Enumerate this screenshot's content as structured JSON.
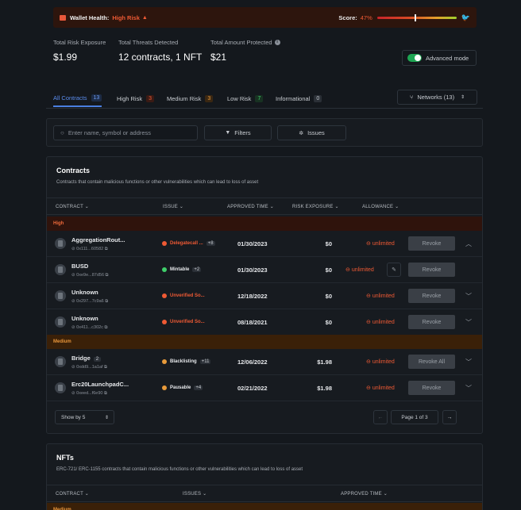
{
  "banner": {
    "label": "Wallet Health:",
    "status": "High Risk",
    "score_label": "Score:",
    "score_value": "47%",
    "score_fraction": 0.47
  },
  "stats": [
    {
      "label": "Total Risk Exposure",
      "value": "$1.99"
    },
    {
      "label": "Total Threats Detected",
      "value": "12 contracts, 1 NFT"
    },
    {
      "label": "Total Amount Protected",
      "value": "$21"
    }
  ],
  "advanced_mode": {
    "label": "Advanced mode",
    "enabled": true
  },
  "tabs": [
    {
      "label": "All Contracts",
      "count": "13"
    },
    {
      "label": "High Risk",
      "count": "3"
    },
    {
      "label": "Medium Risk",
      "count": "3"
    },
    {
      "label": "Low Risk",
      "count": "7"
    },
    {
      "label": "Informational",
      "count": "0"
    }
  ],
  "networks": {
    "label": "Networks (13)"
  },
  "filters": {
    "search_placeholder": "Enter name, symbol or address",
    "filters_label": "Filters",
    "issues_label": "Issues"
  },
  "contracts": {
    "title": "Contracts",
    "subtitle": "Contracts that contain malicious functions or other vulnerabilities which can lead to loss of asset",
    "headers": {
      "contract": "CONTRACT",
      "issue": "ISSUE",
      "approved": "APPROVED TIME",
      "exposure": "RISK EXPOSURE",
      "allowance": "ALLOWANCE"
    },
    "group_high": "High",
    "group_medium": "Medium",
    "rows": [
      {
        "name": "AggregationRout...",
        "address": "0x111...60582",
        "issue": "Delegatecall ...",
        "issue_more": "+8",
        "date": "01/30/2023",
        "exposure": "$0",
        "allowance": "unlimited",
        "action": "Revoke"
      },
      {
        "name": "BUSD",
        "address": "0xe9e...87d56",
        "issue": "Mintable",
        "issue_more": "+2",
        "date": "01/30/2023",
        "exposure": "$0",
        "allowance": "unlimited",
        "action": "Revoke"
      },
      {
        "name": "Unknown",
        "address": "0x297...7c9a6",
        "issue": "Unverified So...",
        "issue_more": "",
        "date": "12/18/2022",
        "exposure": "$0",
        "allowance": "unlimited",
        "action": "Revoke"
      },
      {
        "name": "Unknown",
        "address": "0x411...c302c",
        "issue": "Unverified So...",
        "issue_more": "",
        "date": "08/18/2021",
        "exposure": "$0",
        "allowance": "unlimited",
        "action": "Revoke"
      },
      {
        "name": "Bridge",
        "count": "2",
        "address": "0xdd9...1a1af",
        "issue": "Blacklisting",
        "issue_more": "+11",
        "date": "12/06/2022",
        "exposure": "$1.98",
        "allowance": "unlimited",
        "action": "Revoke All"
      },
      {
        "name": "Erc20LaunchpadC...",
        "address": "0xeed...f6e90",
        "issue": "Pausable",
        "issue_more": "+4",
        "date": "02/21/2022",
        "exposure": "$1.98",
        "allowance": "unlimited",
        "action": "Revoke"
      }
    ],
    "pager": {
      "show_by": "Show by 5",
      "page": "Page 1 of 3"
    }
  },
  "nfts": {
    "title": "NFTs",
    "subtitle": "ERC-721/ ERC-1155 contracts that contain malicious functions or other vulnerabilities which can lead to loss of asset",
    "headers": {
      "contract": "CONTRACT",
      "issues": "ISSUES",
      "approved": "APPROVED TIME"
    },
    "group": "Medium"
  }
}
